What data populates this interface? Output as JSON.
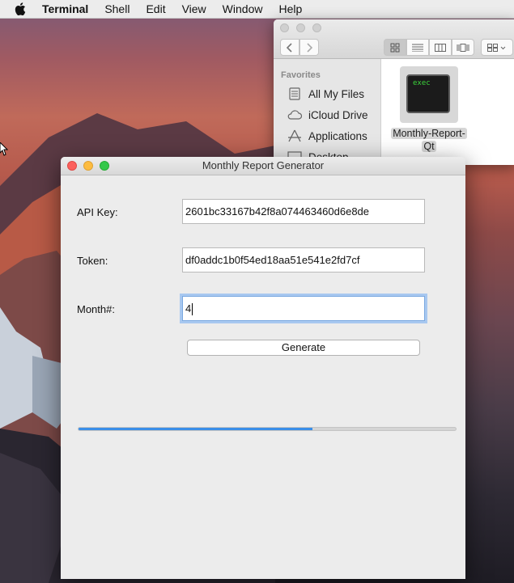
{
  "menubar": {
    "app": "Terminal",
    "items": [
      "Shell",
      "Edit",
      "View",
      "Window",
      "Help"
    ]
  },
  "finder": {
    "sidebar_header": "Favorites",
    "sidebar_items": [
      {
        "label": "All My Files",
        "icon": "all-files-icon"
      },
      {
        "label": "iCloud Drive",
        "icon": "cloud-icon"
      },
      {
        "label": "Applications",
        "icon": "applications-icon"
      },
      {
        "label": "Desktop",
        "icon": "desktop-icon"
      }
    ],
    "file": {
      "icon_text": "exec",
      "name_line1": "Monthly-Report-",
      "name_line2": "Qt"
    }
  },
  "dialog": {
    "title": "Monthly Report Generator",
    "api_key_label": "API Key:",
    "api_key_value": "2601bc33167b42f8a074463460d6e8de",
    "token_label": "Token:",
    "token_value": "df0addc1b0f54ed18aa51e541e2fd7cf",
    "month_label": "Month#:",
    "month_value": "4",
    "generate_label": "Generate",
    "progress_fraction": 0.62,
    "accent_color": "#3a8ee8"
  }
}
